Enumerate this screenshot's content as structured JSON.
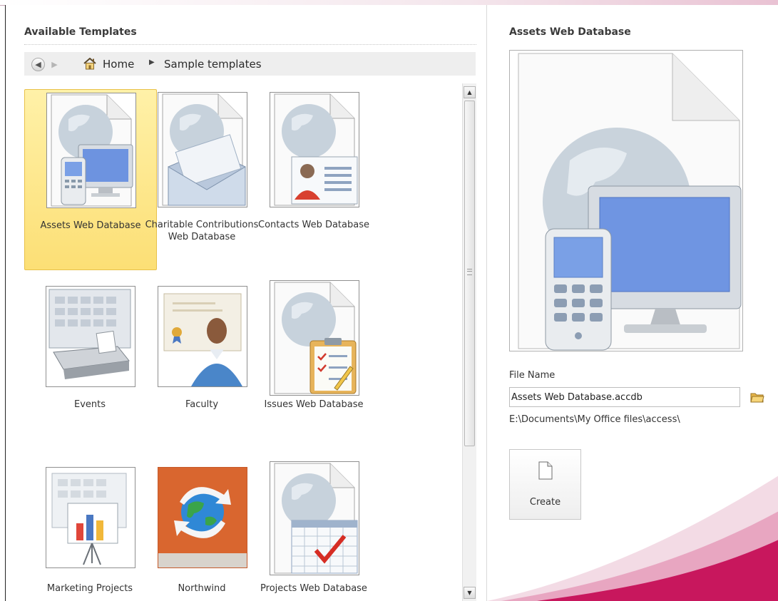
{
  "left": {
    "header": "Available Templates",
    "breadcrumb": {
      "home": "Home",
      "current": "Sample templates"
    }
  },
  "templates": [
    {
      "label": "Assets Web Database",
      "selected": true
    },
    {
      "label": "Charitable Contributions Web Database",
      "selected": false
    },
    {
      "label": "Contacts Web Database",
      "selected": false
    },
    {
      "label": "Events",
      "selected": false
    },
    {
      "label": "Faculty",
      "selected": false
    },
    {
      "label": "Issues Web Database",
      "selected": false
    },
    {
      "label": "Marketing Projects",
      "selected": false
    },
    {
      "label": "Northwind",
      "selected": false
    },
    {
      "label": "Projects Web Database",
      "selected": false
    }
  ],
  "right": {
    "title": "Assets Web Database",
    "file_name_label": "File Name",
    "file_name_value": "Assets Web Database.accdb",
    "path": "E:\\Documents\\My Office files\\access\\",
    "create_label": "Create"
  },
  "colors": {
    "selection": "#fde68a",
    "accent": "#c8175d"
  }
}
